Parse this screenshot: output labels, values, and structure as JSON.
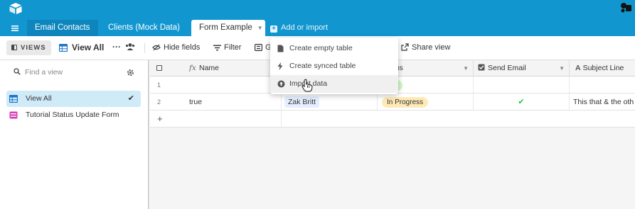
{
  "app": {
    "logo_icon": "airtable-logo-icon",
    "extension_icon": "puzzle-extension-icon"
  },
  "tabs": [
    {
      "label": "Email Contacts",
      "active": false
    },
    {
      "label": "Clients (Mock Data)",
      "active": false
    },
    {
      "label": "Form Example",
      "active": true
    }
  ],
  "add_import": {
    "label": "Add or import"
  },
  "viewbar": {
    "views_label": "VIEWS",
    "current_view": "View All",
    "more_label": "···",
    "hide_fields": "Hide fields",
    "filter": "Filter",
    "group_partial": "G",
    "share_view": "Share view"
  },
  "dropdown": {
    "items": [
      {
        "label": "Create empty table",
        "icon": "table-icon"
      },
      {
        "label": "Create synced table",
        "icon": "lightning-icon"
      },
      {
        "label": "Import data",
        "icon": "upload-icon"
      }
    ]
  },
  "sidebar": {
    "search_placeholder": "Find a view",
    "views": [
      {
        "label": "View All",
        "selected": true,
        "icon": "grid-view-icon"
      },
      {
        "label": "Tutorial Status Update Form",
        "selected": false,
        "icon": "form-view-icon"
      }
    ]
  },
  "grid": {
    "columns": [
      {
        "label": "Name",
        "icon": "formula-icon"
      },
      {
        "label": "",
        "icon": ""
      },
      {
        "label": "tatus",
        "icon": ""
      },
      {
        "label": "Send Email",
        "icon": "checkbox-icon"
      },
      {
        "label": "Subject Line",
        "icon": "text-icon"
      }
    ],
    "rows": [
      {
        "num": "1",
        "name": "",
        "linked": "",
        "status": "Set",
        "send_email": "",
        "subject": ""
      },
      {
        "num": "2",
        "name": "true",
        "linked": "Zak Britt",
        "status": "In Progress",
        "send_email": "✔",
        "subject": "This that & the oth"
      }
    ],
    "add_row": "+"
  },
  "colors": {
    "brand": "#1196d0",
    "selected_view": "#d0ebf8",
    "pill_green": "#d1f7c4",
    "pill_orange": "#ffeab6",
    "check_green": "#20c933"
  }
}
